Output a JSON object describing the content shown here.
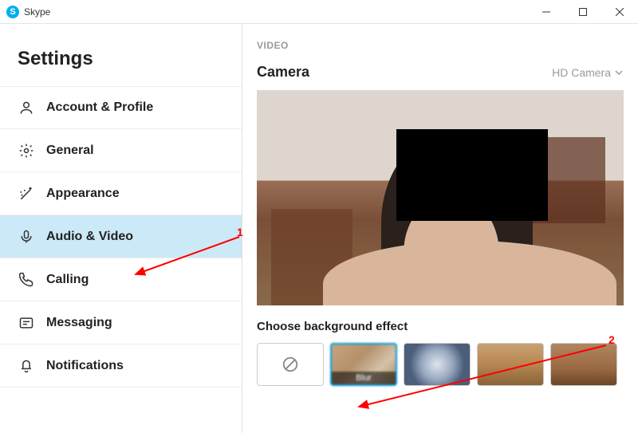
{
  "titlebar": {
    "app_name": "Skype",
    "logo_letter": "S"
  },
  "sidebar": {
    "title": "Settings",
    "items": [
      {
        "label": "Account & Profile",
        "icon": "person"
      },
      {
        "label": "General",
        "icon": "gear"
      },
      {
        "label": "Appearance",
        "icon": "wand"
      },
      {
        "label": "Audio & Video",
        "icon": "mic"
      },
      {
        "label": "Calling",
        "icon": "phone"
      },
      {
        "label": "Messaging",
        "icon": "message"
      },
      {
        "label": "Notifications",
        "icon": "bell"
      }
    ],
    "active_index": 3
  },
  "main": {
    "section_label": "VIDEO",
    "camera_heading": "Camera",
    "camera_selected": "HD Camera",
    "effect_heading": "Choose background effect",
    "effects": [
      {
        "kind": "none",
        "label": ""
      },
      {
        "kind": "blur",
        "label": "Blur"
      },
      {
        "kind": "img",
        "label": ""
      },
      {
        "kind": "img",
        "label": ""
      },
      {
        "kind": "img",
        "label": ""
      }
    ],
    "selected_effect_index": 1
  },
  "annotations": {
    "num1": "1",
    "num2": "2"
  }
}
